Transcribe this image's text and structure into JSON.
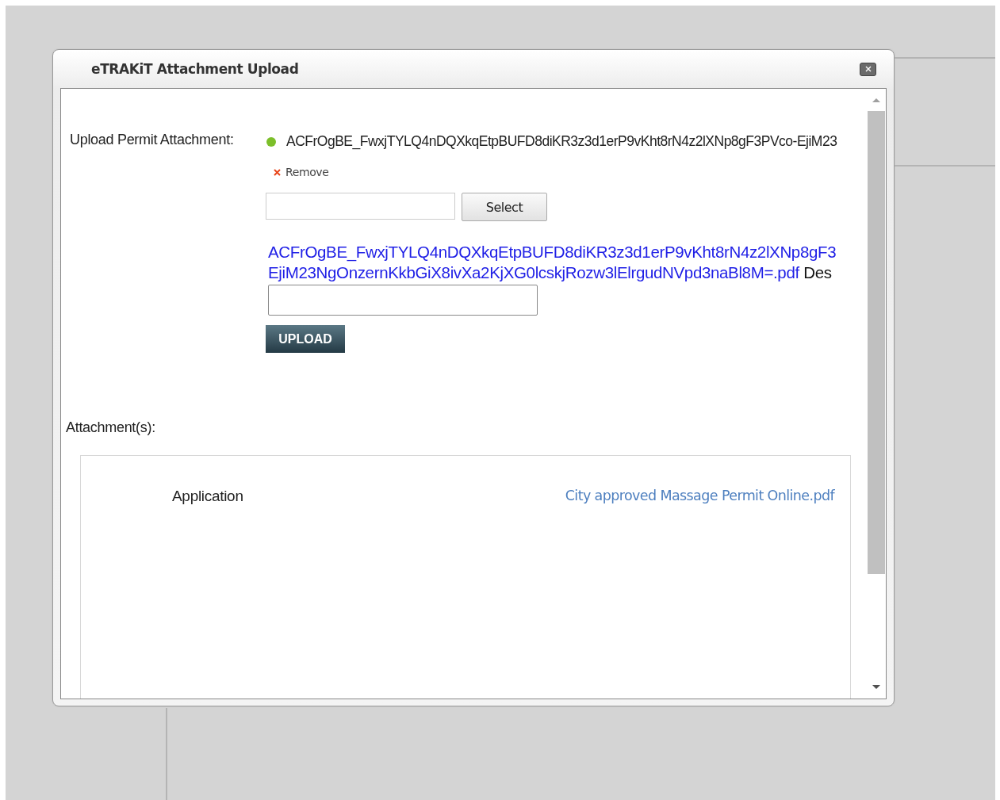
{
  "dialog": {
    "title": "eTRAKiT Attachment Upload",
    "upload_label": "Upload Permit Attachment:",
    "selected_file": {
      "name": "ACFrOgBE_FwxjTYLQ4nDQXkqEtpBUFD8diKR3z3d1erP9vKht8rN4z2lXNp8gF3PVco-EjiM23",
      "remove": "Remove"
    },
    "select_button": "Select",
    "uploaded_link": [
      "ACFrOgBE_FwxjTYLQ4nDQXkqEtpBUFD8diKR3z3d1erP9vKht8rN4z2lXNp8gF3",
      "EjiM23NgOnzernKkbGiX8ivXa2KjXG0lcskjRozw3lElrgudNVpd3naBl8M=.pdf"
    ],
    "description_label": "Des",
    "upload_button": "UPLOAD",
    "attachments_label": "Attachment(s):",
    "attachments": [
      {
        "type": "Application",
        "file": "City approved Massage Permit Online.pdf"
      }
    ]
  }
}
